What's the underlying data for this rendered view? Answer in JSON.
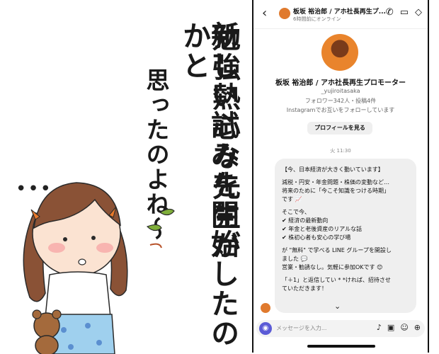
{
  "manga": {
    "column1": "勉強熱心な先生が",
    "column2": "新しい試みを開始したのかと",
    "column3": "思ったのよね〜",
    "ellipsis": "•••"
  },
  "chat": {
    "header": {
      "name": "板坂 裕治郎 / アホ社長再生プ...",
      "status": "6時間前にオンライン",
      "icons": [
        "back-chevron-icon",
        "phone-icon",
        "video-icon",
        "tag-icon"
      ]
    },
    "profile": {
      "name": "板坂 裕治郎 / アホ社長再生プロモーター",
      "handle": "_yujiroitasaka",
      "stats": "フォロワー342人・投稿4件",
      "mutual": "Instagramでお互いをフォローしています",
      "view_button": "プロフィールを見る"
    },
    "timestamp": "火 11:30",
    "message": {
      "line1": "【今、日本経済が大きく動いています】",
      "line2": "減税・円安・年金問題・株価の変動など…",
      "line3": "将来のために「今こそ知識をつける時期」",
      "line4": "です 📈",
      "line5": "そこで今、",
      "line6": "✔ 経済の最新動向",
      "line7": "✔ 年金と老後資産のリアルな話",
      "line8": "✔ 株初心者も安心の学び場",
      "line9": "が \"無料\" で学べる LINE グループを開設し",
      "line10": "ました 💬",
      "line11": "営業・勧誘なし。気軽に参加OKです 😊",
      "line12": "「＋1」と返信してい * *ければ、招待させ",
      "line13": "ていただきます！"
    },
    "composer": {
      "placeholder": "メッセージを入力...",
      "icons": [
        "camera-icon",
        "mic-icon",
        "image-icon",
        "sticker-icon",
        "add-icon"
      ]
    }
  }
}
